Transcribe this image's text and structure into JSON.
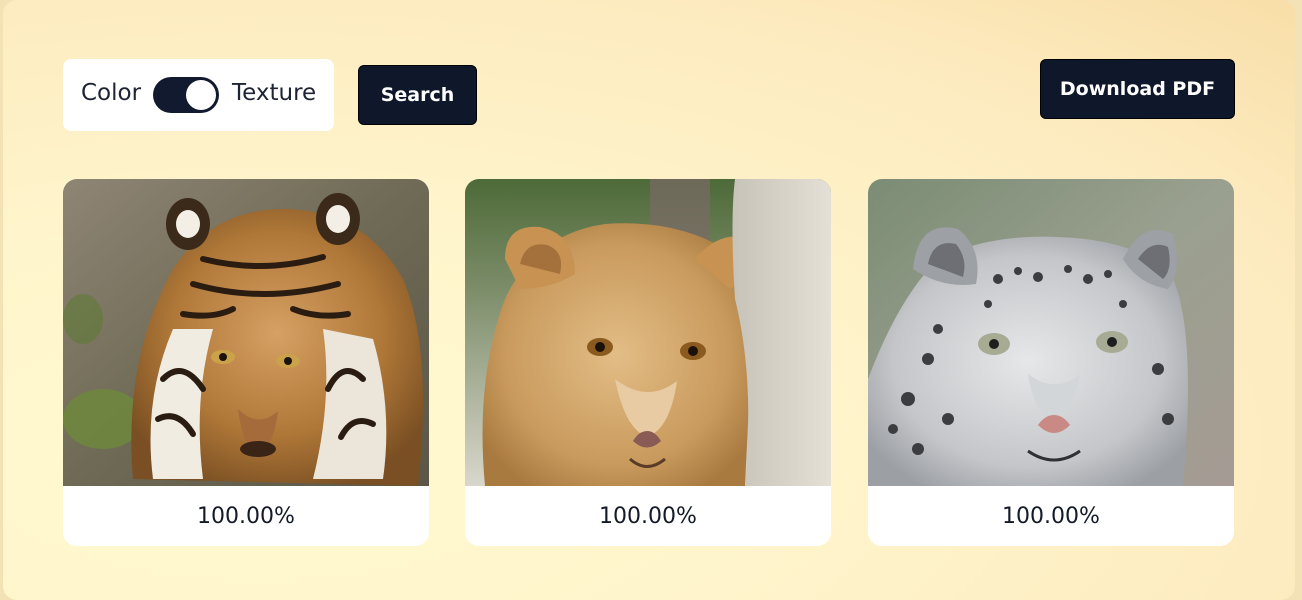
{
  "controls": {
    "toggle": {
      "left_label": "Color",
      "right_label": "Texture",
      "state": "Texture"
    },
    "search_label": "Search",
    "download_label": "Download PDF"
  },
  "results": [
    {
      "animal": "tiger-photo",
      "score": "100.00%"
    },
    {
      "animal": "lioness-photo",
      "score": "100.00%"
    },
    {
      "animal": "snow-leopard-photo",
      "score": "100.00%"
    }
  ],
  "colors": {
    "accent": "#0f172a",
    "background": "#fff5cc"
  }
}
